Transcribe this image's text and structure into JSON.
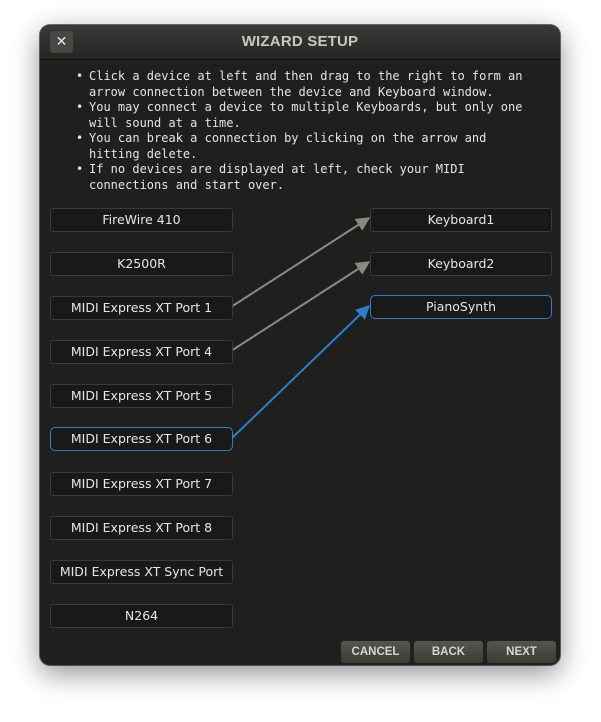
{
  "window": {
    "title": "WIZARD SETUP",
    "close_icon": "✕"
  },
  "instructions": [
    "Click a device at left and then drag to the right to form an arrow connection between the device and Keyboard window.",
    "You may connect a device to multiple Keyboards, but only one will sound at a time.",
    "You can break a connection by clicking on the arrow and hitting delete.",
    "If no devices are displayed at left, check your MIDI connections and start over."
  ],
  "devices": [
    "FireWire 410",
    "K2500R",
    "MIDI Express XT Port 1",
    "MIDI Express XT Port 4",
    "MIDI Express XT Port 5",
    "MIDI Express XT Port 6",
    "MIDI Express XT Port 7",
    "MIDI Express XT Port 8",
    "MIDI Express XT Sync Port",
    "N264"
  ],
  "selected_device": "MIDI Express XT Port 6",
  "keyboards": [
    "Keyboard1",
    "Keyboard2",
    "PianoSynth"
  ],
  "selected_keyboard": "PianoSynth",
  "connections": [
    {
      "from": "MIDI Express XT Port 1",
      "to": "Keyboard1",
      "selected": false
    },
    {
      "from": "MIDI Express XT Port 4",
      "to": "Keyboard2",
      "selected": false
    },
    {
      "from": "MIDI Express XT Port 6",
      "to": "PianoSynth",
      "selected": true
    }
  ],
  "buttons": {
    "cancel": "CANCEL",
    "back": "BACK",
    "next": "NEXT"
  },
  "colors": {
    "selection_accent": "#2a7fd0",
    "connection_arrow": "#8a8a84",
    "window_background": "#1f1f1d"
  }
}
